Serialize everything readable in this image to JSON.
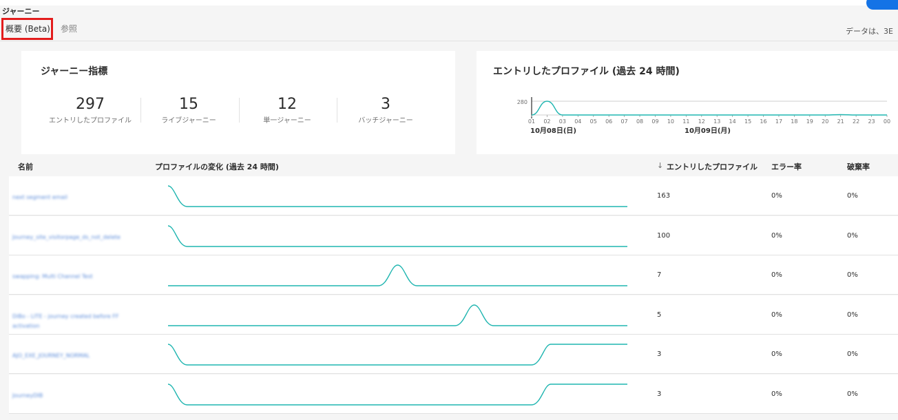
{
  "header": {
    "title": "ジャーニー",
    "tabs": [
      {
        "label": "概要 (Beta)",
        "active": true
      },
      {
        "label": "参照",
        "active": false
      }
    ],
    "data_note": "データは、3E"
  },
  "metrics_card": {
    "title": "ジャーニー指標",
    "items": [
      {
        "value": "297",
        "label": "エントリしたプロファイル"
      },
      {
        "value": "15",
        "label": "ライブジャーニー"
      },
      {
        "value": "12",
        "label": "単一ジャーニー"
      },
      {
        "value": "3",
        "label": "バッチジャーニー"
      }
    ]
  },
  "entry_card": {
    "title": "エントリしたプロファイル (過去 24 時間)",
    "y_tick": "280",
    "date_labels": [
      "10月08日(日)",
      "10月09日(月)"
    ]
  },
  "chart_data": {
    "type": "line",
    "title": "エントリしたプロファイル (過去 24 時間)",
    "x": [
      "01",
      "02",
      "03",
      "04",
      "05",
      "06",
      "07",
      "08",
      "09",
      "10",
      "11",
      "12",
      "13",
      "14",
      "15",
      "16",
      "17",
      "18",
      "19",
      "20",
      "21",
      "22",
      "23",
      "00"
    ],
    "series": [
      {
        "values": [
          0,
          280,
          0,
          0,
          0,
          0,
          0,
          0,
          0,
          0,
          0,
          0,
          0,
          0,
          0,
          0,
          0,
          0,
          0,
          0,
          7,
          0,
          0,
          0
        ]
      }
    ],
    "yticks": [
      "280"
    ],
    "date_labels": [
      "10月08日(日)",
      "10月09日(月)"
    ],
    "color": "#1fb5b0"
  },
  "table": {
    "columns": {
      "name": "名前",
      "change": "プロファイルの変化 (過去 24 時間)",
      "sort_icon": "↓",
      "entered": "エントリしたプロファイル",
      "error_rate": "エラー率",
      "discard_rate": "破棄率"
    },
    "rows": [
      {
        "name": "next segment email",
        "entered": "163",
        "error_rate": "0%",
        "discard_rate": "0%",
        "spark": [
          1.0,
          0.0,
          0.0,
          0.0,
          0.0,
          0.0,
          0.0
        ]
      },
      {
        "name": "Journey_site_visitorpage_ds_not_delete",
        "entered": "100",
        "error_rate": "0%",
        "discard_rate": "0%",
        "spark": [
          1.0,
          0.0,
          0.0,
          0.0,
          0.0,
          0.0,
          0.0
        ]
      },
      {
        "name": "swapping: Multi Channel Test",
        "entered": "7",
        "error_rate": "0%",
        "discard_rate": "0%",
        "spark": [
          0.0,
          0.0,
          0.0,
          1.0,
          0.0,
          0.0,
          0.0
        ]
      },
      {
        "name": "DiBo - LITE - journey created before FF activation",
        "entered": "5",
        "error_rate": "0%",
        "discard_rate": "0%",
        "spark": [
          0.0,
          0.0,
          0.0,
          0.0,
          1.0,
          0.0,
          0.0
        ]
      },
      {
        "name": "AJO_EXE_JOURNEY_NORMAL",
        "entered": "3",
        "error_rate": "0%",
        "discard_rate": "0%",
        "spark": [
          1.0,
          0.0,
          0.0,
          0.0,
          0.0,
          1.0,
          1.0
        ]
      },
      {
        "name": "JourneyDIB",
        "entered": "3",
        "error_rate": "0%",
        "discard_rate": "0%",
        "spark": [
          1.0,
          0.0,
          0.0,
          0.0,
          0.0,
          1.0,
          1.0
        ]
      }
    ]
  }
}
